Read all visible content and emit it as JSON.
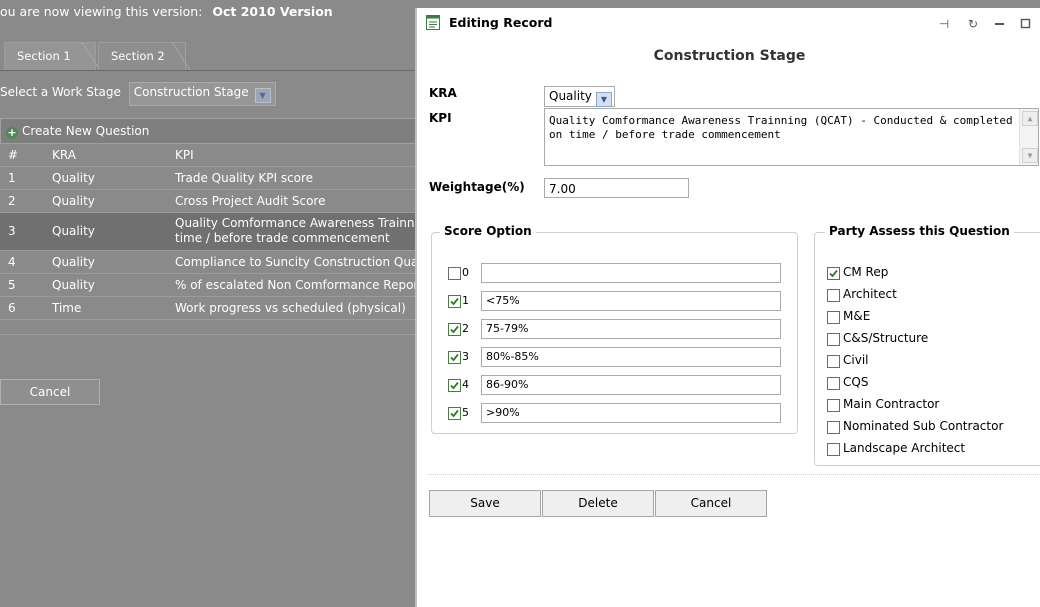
{
  "background": {
    "version_prefix": "ou are now viewing this version:",
    "version_value": "Oct 2010 Version",
    "tabs": [
      {
        "label": "Section 1"
      },
      {
        "label": "Section 2"
      }
    ],
    "work_stage_label": "Select a Work Stage",
    "work_stage_value": "Construction Stage",
    "create_label": "Create New Question",
    "columns": {
      "num": "#",
      "kra": "KRA",
      "kpi": "KPI"
    },
    "rows": [
      {
        "num": "1",
        "kra": "Quality",
        "kpi": "Trade Quality KPI score"
      },
      {
        "num": "2",
        "kra": "Quality",
        "kpi": "Cross Project Audit Score"
      },
      {
        "num": "3",
        "kra": "Quality",
        "kpi": "Quality Comformance Awareness Trainni time / before trade commencement"
      },
      {
        "num": "4",
        "kra": "Quality",
        "kpi": "Compliance to Suncity Construction Qua"
      },
      {
        "num": "5",
        "kra": "Quality",
        "kpi": "% of escalated Non Comformance Repor"
      },
      {
        "num": "6",
        "kra": "Time",
        "kpi": "Work progress vs scheduled (physical)"
      }
    ],
    "cancel_label": "Cancel"
  },
  "dialog": {
    "title": "Editing Record",
    "stage_title": "Construction Stage",
    "kra_label": "KRA",
    "kra_value": "Quality",
    "kpi_label": "KPI",
    "kpi_value": "Quality Comformance Awareness Trainning (QCAT) - Conducted & completed on time / before trade commencement",
    "weight_label": "Weightage(%)",
    "weight_value": "7.00",
    "score_legend": "Score Option",
    "score_options": [
      {
        "num": "0",
        "value": "",
        "checked": false
      },
      {
        "num": "1",
        "value": "<75%",
        "checked": true
      },
      {
        "num": "2",
        "value": "75-79%",
        "checked": true
      },
      {
        "num": "3",
        "value": "80%-85%",
        "checked": true
      },
      {
        "num": "4",
        "value": "86-90%",
        "checked": true
      },
      {
        "num": "5",
        "value": ">90%",
        "checked": true
      }
    ],
    "party_legend": "Party Assess this Question",
    "parties": [
      {
        "label": "CM Rep",
        "checked": true
      },
      {
        "label": "Architect",
        "checked": false
      },
      {
        "label": "M&E",
        "checked": false
      },
      {
        "label": "C&S/Structure",
        "checked": false
      },
      {
        "label": "Civil",
        "checked": false
      },
      {
        "label": "CQS",
        "checked": false
      },
      {
        "label": "Main Contractor",
        "checked": false
      },
      {
        "label": "Nominated Sub Contractor",
        "checked": false
      },
      {
        "label": "Landscape Architect",
        "checked": false
      }
    ],
    "buttons": {
      "save": "Save",
      "delete": "Delete",
      "cancel": "Cancel"
    }
  }
}
